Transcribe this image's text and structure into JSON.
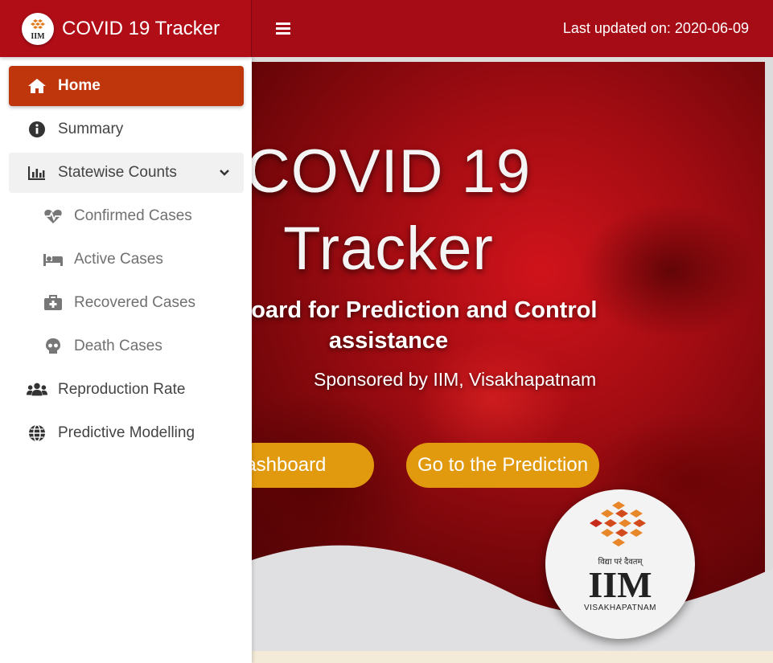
{
  "app": {
    "title": "COVID 19 Tracker"
  },
  "topbar": {
    "last_updated": "Last updated on: 2020-06-09"
  },
  "sidebar": {
    "items": [
      {
        "label": "Home",
        "icon": "home-icon"
      },
      {
        "label": "Summary",
        "icon": "info-icon"
      },
      {
        "label": "Statewise Counts",
        "icon": "bar-chart-icon",
        "expanded": true
      },
      {
        "label": "Confirmed Cases",
        "icon": "heartbeat-icon"
      },
      {
        "label": "Active Cases",
        "icon": "bed-icon"
      },
      {
        "label": "Recovered Cases",
        "icon": "first-aid-kit-icon"
      },
      {
        "label": "Death Cases",
        "icon": "skull-icon"
      },
      {
        "label": "Reproduction Rate",
        "icon": "users-icon"
      },
      {
        "label": "Predictive Modelling",
        "icon": "globe-icon"
      }
    ]
  },
  "hero": {
    "title_line1": "COVID 19",
    "title_line2": "Tracker",
    "subtitle_line1": "Dashboard for Prediction and Control",
    "subtitle_line2": "assistance",
    "sponsor": "Sponsored by IIM, Visakhapatnam",
    "buttons": {
      "dashboard": "Go to the Dashboard",
      "prediction": "Go to the Prediction"
    },
    "badge": {
      "motto": "विद्या परं दैवतम्",
      "name": "IIM",
      "city": "VISAKHAPATNAM"
    }
  },
  "colors": {
    "header": "#b00d17",
    "active_nav": "#c0360c",
    "button": "#e19a0e"
  }
}
